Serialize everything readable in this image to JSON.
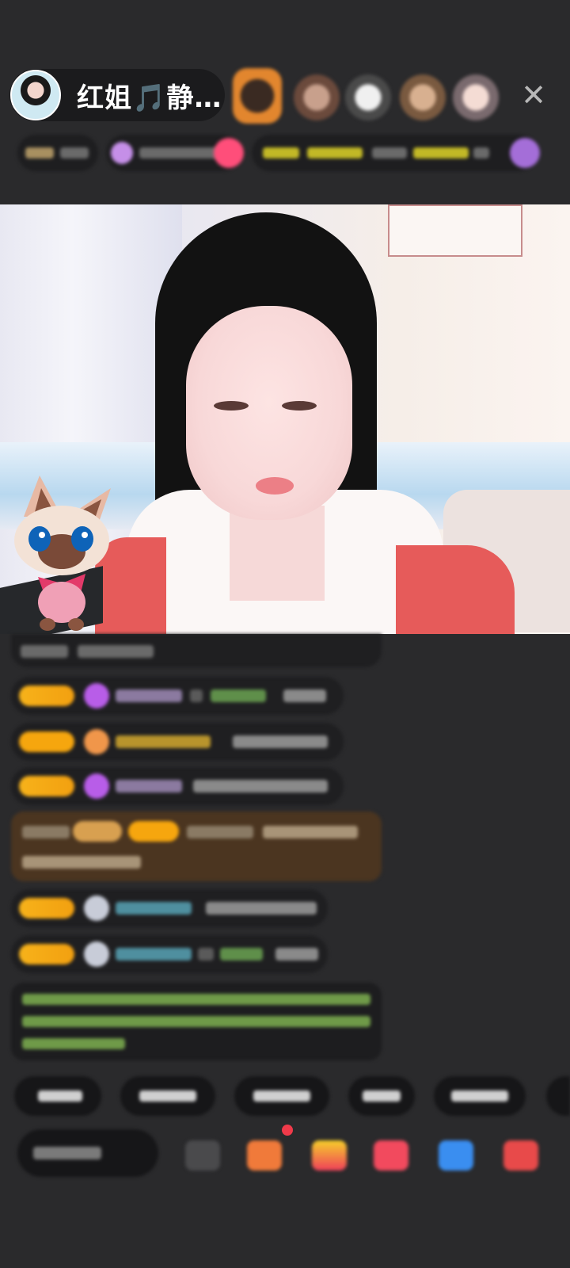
{
  "host": {
    "name": "红姐🎵静…"
  },
  "header": {
    "close_icon": "close-icon"
  },
  "colors": {
    "level_badge": "#f7b21a",
    "gift_banner": "#5a3e22",
    "notice_text": "#9acd57",
    "chat_bg": "#2a2a2c"
  }
}
